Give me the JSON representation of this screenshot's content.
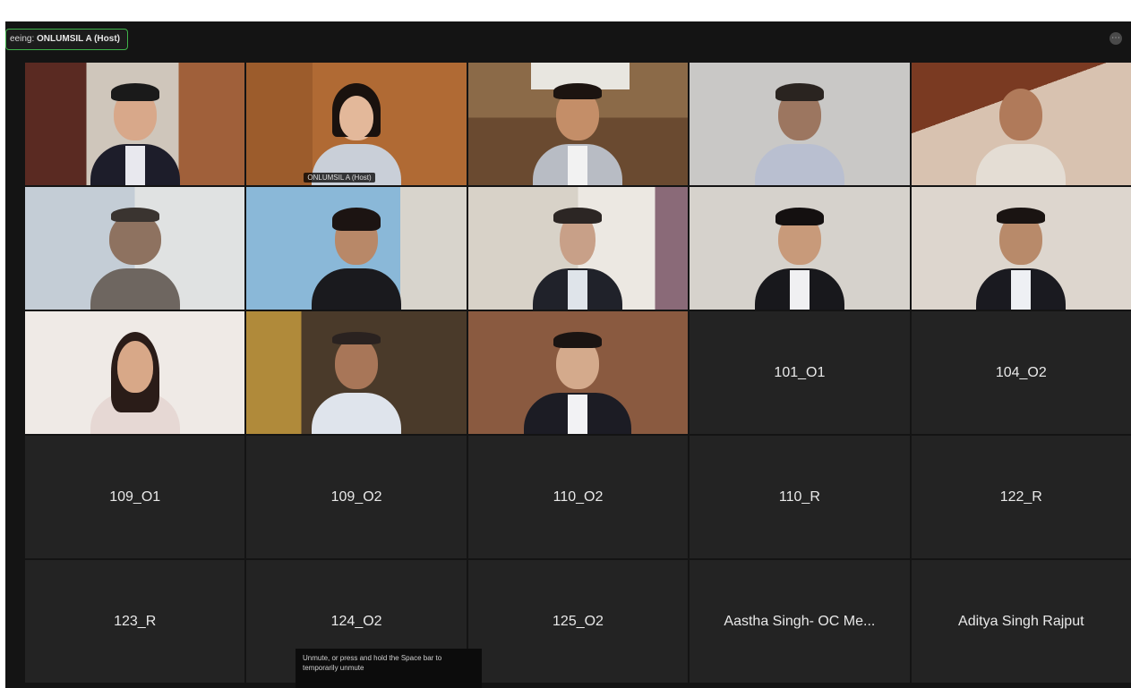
{
  "header": {
    "viewing_prefix": "eeing",
    "viewing_name": "ONLUMSIL A (Host)",
    "options_icon": "ellipsis-icon"
  },
  "video_tiles": [
    {
      "id": "v1",
      "name": "",
      "active": false
    },
    {
      "id": "v2",
      "name": "ONLUMSIL A (Host)",
      "active": true
    },
    {
      "id": "v3",
      "name": "",
      "active": false
    },
    {
      "id": "v4",
      "name": "",
      "active": false
    },
    {
      "id": "v5",
      "name": "",
      "active": false
    },
    {
      "id": "v6",
      "name": "",
      "active": false
    },
    {
      "id": "v7",
      "name": "",
      "active": false
    },
    {
      "id": "v8",
      "name": "",
      "active": false
    },
    {
      "id": "v9",
      "name": "",
      "active": false
    },
    {
      "id": "v10",
      "name": "",
      "active": false
    },
    {
      "id": "v11",
      "name": "",
      "active": false
    },
    {
      "id": "v12",
      "name": "",
      "active": false
    },
    {
      "id": "v13",
      "name": "",
      "active": false
    }
  ],
  "name_tiles": [
    "101_O1",
    "104_O2",
    "109_O1",
    "109_O2",
    "110_O2",
    "110_R",
    "122_R",
    "123_R",
    "124_O2",
    "125_O2",
    "Aastha Singh- OC Me...",
    "Aditya Singh Rajput"
  ],
  "tooltip": {
    "text": "Unmute, or press and hold the Space bar to temporarily unmute"
  },
  "colors": {
    "background": "#141414",
    "tile": "#232323",
    "active_border": "#3fb24a",
    "name_text": "#e9e9e9"
  }
}
